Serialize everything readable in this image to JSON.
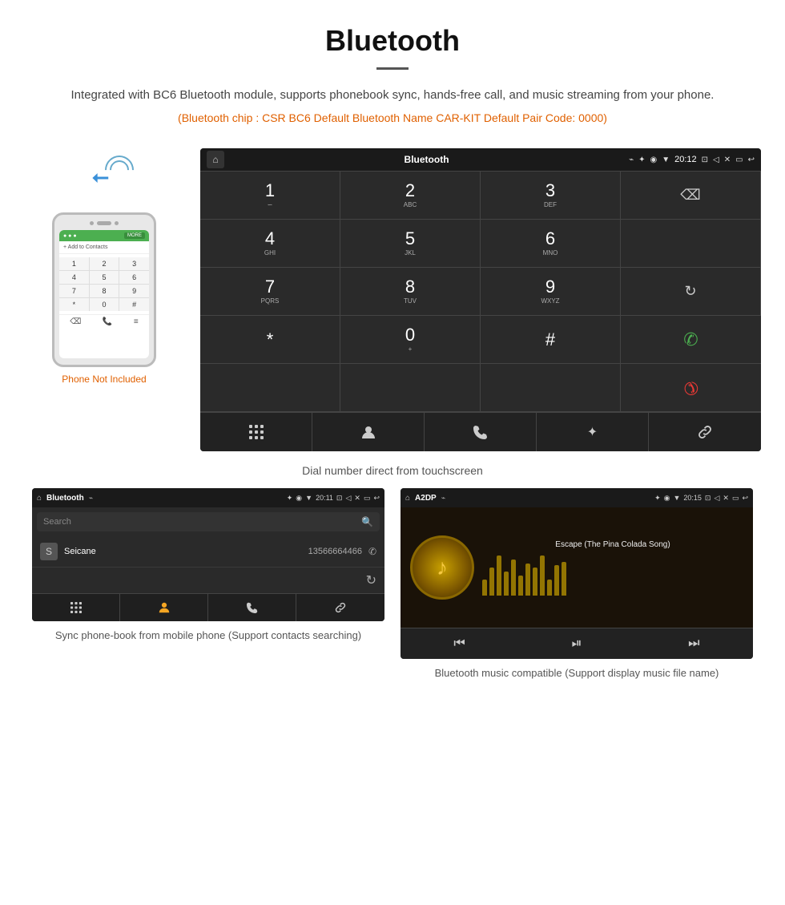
{
  "page": {
    "title": "Bluetooth",
    "divider": true,
    "description": "Integrated with BC6 Bluetooth module, supports phonebook sync, hands-free call, and music streaming from your phone.",
    "specs": "(Bluetooth chip : CSR BC6    Default Bluetooth Name CAR-KIT    Default Pair Code: 0000)"
  },
  "phone_label": "Phone Not Included",
  "main_caption": "Dial number direct from touchscreen",
  "dial_screen": {
    "status_title": "Bluetooth",
    "time": "20:12",
    "keys": [
      {
        "num": "1",
        "sub": "∽"
      },
      {
        "num": "2",
        "sub": "ABC"
      },
      {
        "num": "3",
        "sub": "DEF"
      },
      {
        "num": "",
        "sub": "",
        "action": "delete"
      },
      {
        "num": "4",
        "sub": "GHI"
      },
      {
        "num": "5",
        "sub": "JKL"
      },
      {
        "num": "6",
        "sub": "MNO"
      },
      {
        "num": "",
        "sub": "",
        "action": "empty"
      },
      {
        "num": "7",
        "sub": "PQRS"
      },
      {
        "num": "8",
        "sub": "TUV"
      },
      {
        "num": "9",
        "sub": "WXYZ"
      },
      {
        "num": "",
        "sub": "",
        "action": "sync"
      },
      {
        "num": "*",
        "sub": ""
      },
      {
        "num": "0",
        "sub": "+"
      },
      {
        "num": "#",
        "sub": ""
      },
      {
        "num": "",
        "sub": "",
        "action": "call_green"
      },
      {
        "num": "",
        "sub": "",
        "action": "empty2"
      },
      {
        "num": "",
        "sub": "",
        "action": "empty3"
      },
      {
        "num": "",
        "sub": "",
        "action": "empty4"
      },
      {
        "num": "",
        "sub": "",
        "action": "call_red"
      }
    ]
  },
  "phonebook_screen": {
    "title": "Bluetooth",
    "search_placeholder": "Search",
    "contact_name": "Seicane",
    "contact_number": "13566664466",
    "contact_initial": "S"
  },
  "music_screen": {
    "title": "A2DP",
    "time": "20:15",
    "song_title": "Escape (The Pina Colada Song)",
    "viz_heights": [
      20,
      35,
      50,
      30,
      45,
      25,
      40,
      35,
      50,
      20,
      38,
      42
    ]
  },
  "bottom_captions": {
    "phonebook": "Sync phone-book from mobile phone\n(Support contacts searching)",
    "music": "Bluetooth music compatible\n(Support display music file name)"
  },
  "icons": {
    "home": "⌂",
    "bluetooth": "✦",
    "usb": "⌁",
    "bt_symbol": "⎋",
    "location": "⊙",
    "wifi_signal": "▼",
    "camera": "⊡",
    "volume": "◁",
    "close_x": "✕",
    "window": "▭",
    "back": "↩",
    "delete_key": "⌫",
    "sync": "↻",
    "call_green": "✆",
    "call_red": "✆",
    "keypad": "⊞",
    "contacts": "👤",
    "phone": "✆",
    "bt": "✦",
    "link": "⛓",
    "search": "🔍",
    "rewind": "⏮",
    "play_pause": "⏯",
    "forward": "⏭"
  }
}
